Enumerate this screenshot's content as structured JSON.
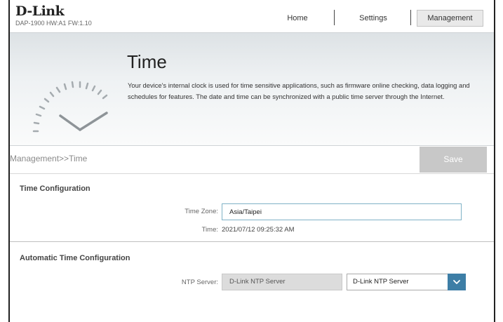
{
  "brand": {
    "logo": "D-Link",
    "model": "DAP-1900 HW:A1 FW:1.10"
  },
  "nav": {
    "home": "Home",
    "settings": "Settings",
    "management": "Management"
  },
  "banner": {
    "title": "Time",
    "description": "Your device's internal clock is used for time sensitive applications, such as firmware online checking, data logging and schedules for features. The date and time can be synchronized with a public time server through the Internet."
  },
  "breadcrumb": "Management>>Time",
  "save_label": "Save",
  "time_config": {
    "title": "Time Configuration",
    "timezone_label": "Time Zone:",
    "timezone_value": "Asia/Taipei",
    "time_label": "Time:",
    "time_value": "2021/07/12 09:25:32 AM"
  },
  "auto_time": {
    "title": "Automatic Time Configuration",
    "ntp_label": "NTP Server:",
    "ntp_value": "D-Link NTP Server",
    "ntp_selected": "D-Link NTP Server"
  },
  "colors": {
    "accent": "#3d7ea6",
    "save_disabled": "#c8c8c8"
  },
  "icons": {
    "banner": "clock-icon",
    "dropdown": "chevron-down-icon"
  }
}
